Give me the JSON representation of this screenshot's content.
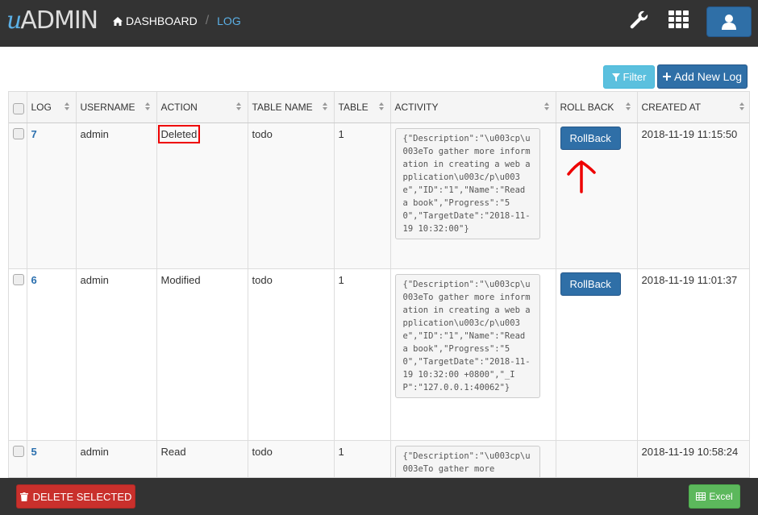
{
  "header": {
    "logo_prefix": "u",
    "logo_text": "ADMIN",
    "breadcrumb_home": "DASHBOARD",
    "breadcrumb_separator": "/",
    "breadcrumb_current": "LOG",
    "icons": [
      "wrench-icon",
      "apps-grid-icon",
      "user-icon"
    ]
  },
  "toolbar": {
    "filter_label": "Filter",
    "add_label": "Add New Log"
  },
  "table": {
    "columns": [
      "LOG",
      "USERNAME",
      "ACTION",
      "TABLE NAME",
      "TABLE",
      "ACTIVITY",
      "ROLL BACK",
      "CREATED AT"
    ],
    "rows": [
      {
        "log": "7",
        "username": "admin",
        "action": "Deleted",
        "table_name": "todo",
        "table": "1",
        "activity": "{\"Description\":\"\\u003cp\\u003eTo gather more information in creating a web application\\u003c/p\\u003e\",\"ID\":\"1\",\"Name\":\"Read a book\",\"Progress\":\"50\",\"TargetDate\":\"2018-11-19 10:32:00\"}",
        "rollback": "RollBack",
        "created_at": "2018-11-19 11:15:50"
      },
      {
        "log": "6",
        "username": "admin",
        "action": "Modified",
        "table_name": "todo",
        "table": "1",
        "activity": "{\"Description\":\"\\u003cp\\u003eTo gather more information in creating a web application\\u003c/p\\u003e\",\"ID\":\"1\",\"Name\":\"Read a book\",\"Progress\":\"50\",\"TargetDate\":\"2018-11-19 10:32:00 +0800\",\"_IP\":\"127.0.0.1:40062\"}",
        "rollback": "RollBack",
        "created_at": "2018-11-19 11:01:37"
      },
      {
        "log": "5",
        "username": "admin",
        "action": "Read",
        "table_name": "todo",
        "table": "1",
        "activity": "{\"Description\":\"\\u003cp\\u003eTo gather more",
        "rollback": "",
        "created_at": "2018-11-19 10:58:24"
      }
    ]
  },
  "footer": {
    "delete_label": "DELETE SELECTED",
    "excel_label": "Excel"
  },
  "colors": {
    "topbar": "#333333",
    "primary": "#2f6fa7",
    "info": "#5bc0de",
    "danger": "#c9302c",
    "success": "#5cb85c",
    "highlight": "#ee0000"
  }
}
